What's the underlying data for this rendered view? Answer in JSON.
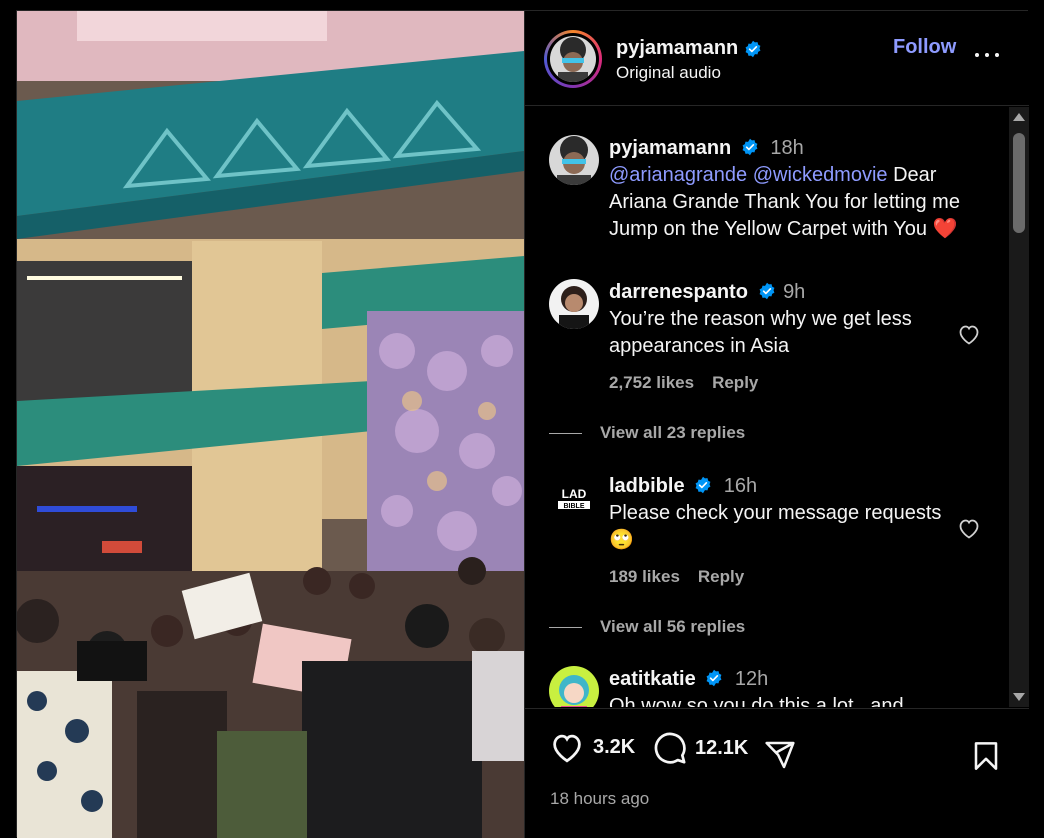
{
  "header": {
    "username": "pyjamamann",
    "subtitle": "Original audio",
    "follow_label": "Follow"
  },
  "comments": [
    {
      "username": "pyjamamann",
      "time": "18h",
      "mentions": [
        "@arianagrande",
        "@wickedmovie"
      ],
      "text": "Dear Ariana Grande Thank You for letting me Jump on the Yellow Carpet with You ❤️"
    },
    {
      "username": "darrenespanto",
      "time": "9h",
      "text": "You’re the reason why we get less appearances in Asia",
      "likes": "2,752 likes",
      "reply_label": "Reply",
      "view_replies": "View all 23 replies"
    },
    {
      "username": "ladbible",
      "time": "16h",
      "text": "Please check your message requests 🙄",
      "likes": "189 likes",
      "reply_label": "Reply",
      "view_replies": "View all 56 replies"
    },
    {
      "username": "eatitkatie",
      "time": "12h",
      "text": "Oh wow so you do this a lot...and"
    }
  ],
  "footer": {
    "likes_count": "3.2K",
    "comments_count": "12.1K",
    "timestamp": "18 hours ago"
  },
  "icons": {
    "verified": "verified-badge-icon",
    "like": "heart-icon",
    "comment": "comment-icon",
    "share": "share-icon",
    "save": "bookmark-icon",
    "more": "more-options-icon"
  },
  "colors": {
    "accent_link": "#8e9bff",
    "verified": "#0095f6",
    "muted": "#a8a8a8",
    "background": "#000000"
  }
}
